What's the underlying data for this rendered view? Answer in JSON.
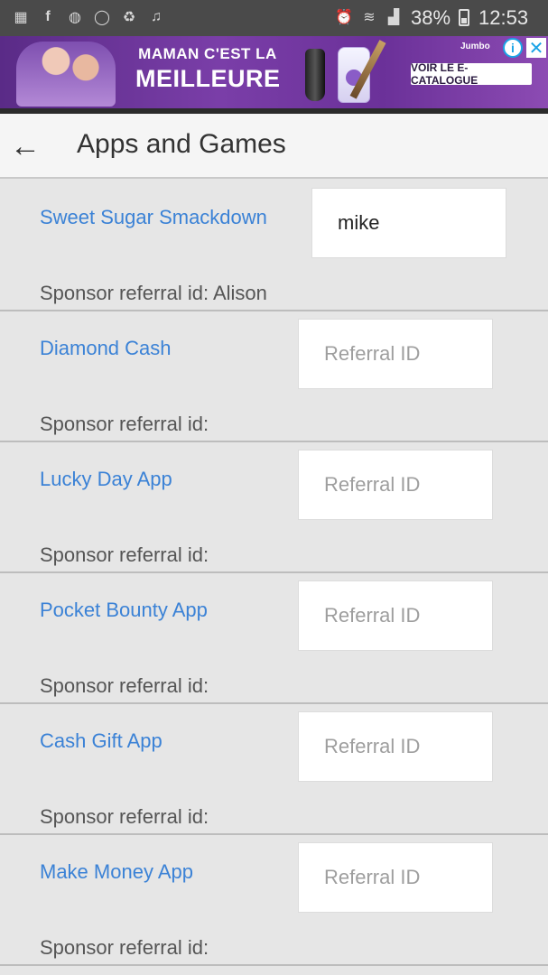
{
  "status_bar": {
    "battery": "38%",
    "time": "12:53",
    "left_icons": [
      "gallery-icon",
      "facebook-icon",
      "messenger-icon",
      "whatsapp-icon",
      "recycle-icon",
      "music-icon"
    ],
    "right_icons": [
      "alarm-icon",
      "wifi-icon",
      "signal-icon",
      "battery-icon"
    ]
  },
  "ad": {
    "headline_line1": "MAMAN C'EST LA",
    "headline_line2": "MEILLEURE",
    "brand": "Jumbo",
    "cta": "VOIR LE E-CATALOGUE",
    "info": "i",
    "close": "✕"
  },
  "app_bar": {
    "back": "←",
    "title": "Apps and Games"
  },
  "apps": [
    {
      "name": "Sweet Sugar Smackdown",
      "sponsor": "Sponsor referral id: Alison",
      "value": "mike",
      "placeholder": "Referral ID"
    },
    {
      "name": "Diamond Cash",
      "sponsor": "Sponsor referral id:",
      "value": "",
      "placeholder": "Referral ID"
    },
    {
      "name": "Lucky Day App",
      "sponsor": "Sponsor referral id:",
      "value": "",
      "placeholder": "Referral ID"
    },
    {
      "name": "Pocket Bounty App",
      "sponsor": "Sponsor referral id:",
      "value": "",
      "placeholder": "Referral ID"
    },
    {
      "name": "Cash Gift App",
      "sponsor": "Sponsor referral id:",
      "value": "",
      "placeholder": "Referral ID"
    },
    {
      "name": "Make Money App",
      "sponsor": "Sponsor referral id:",
      "value": "",
      "placeholder": "Referral ID"
    }
  ]
}
